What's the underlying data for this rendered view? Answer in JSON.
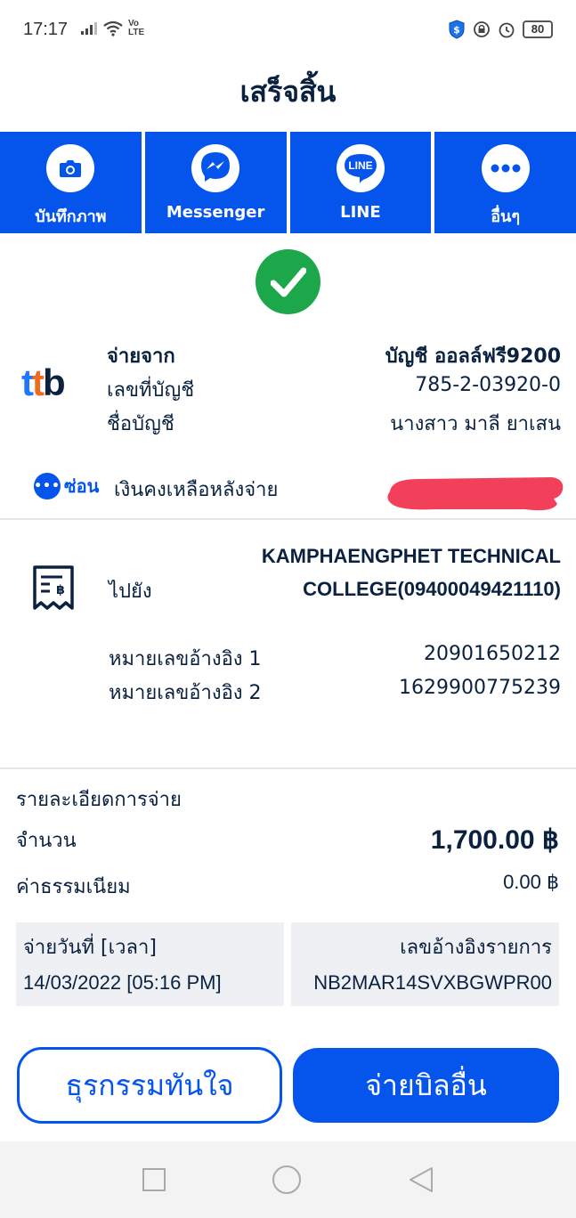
{
  "status_bar": {
    "time": "17:17",
    "volte": "Vo\nLTE",
    "battery": "80"
  },
  "header": {
    "title": "เสร็จสิ้น"
  },
  "share": [
    {
      "label": "บันทึกภาพ",
      "icon": "camera-icon"
    },
    {
      "label": "Messenger",
      "icon": "messenger-icon"
    },
    {
      "label": "LINE",
      "icon": "line-icon",
      "icon_text": "LINE"
    },
    {
      "label": "อื่นๆ",
      "icon": "more-icon"
    }
  ],
  "from": {
    "bank_logo": "ttb",
    "pay_from_label": "จ่ายจาก",
    "pay_from_value": "บัญชี ออลล์ฟรี9200",
    "account_no_label": "เลขที่บัญชี",
    "account_no_value": "785-2-03920-0",
    "account_name_label": "ชื่อบัญชี",
    "account_name_value": "นางสาว มาลี ยาเสน",
    "hide_label": "ซ่อน",
    "balance_label": "เงินคงเหลือหลังจ่าย"
  },
  "to": {
    "to_label": "ไปยัง",
    "to_value": "KAMPHAENGPHET TECHNICAL COLLEGE(09400049421110)",
    "ref1_label": "หมายเลขอ้างอิง 1",
    "ref1_value": "20901650212",
    "ref2_label": "หมายเลขอ้างอิง 2",
    "ref2_value": "1629900775239"
  },
  "details": {
    "title": "รายละเอียดการจ่าย",
    "amount_label": "จำนวน",
    "amount_value": "1,700.00 ฿",
    "fee_label": "ค่าธรรมเนียม",
    "fee_value": "0.00 ฿",
    "date_label": "จ่ายวันที่ [เวลา]",
    "date_value": "14/03/2022 [05:16 PM]",
    "ref_label": "เลขอ้างอิงรายการ",
    "ref_value": "NB2MAR14SVXBGWPR00"
  },
  "buttons": {
    "quick_transaction": "ธุรกรรมทันใจ",
    "pay_other_bill": "จ่ายบิลอื่น"
  },
  "colors": {
    "primary": "#0555ec",
    "success": "#1ca84a",
    "text": "#0a2240"
  }
}
